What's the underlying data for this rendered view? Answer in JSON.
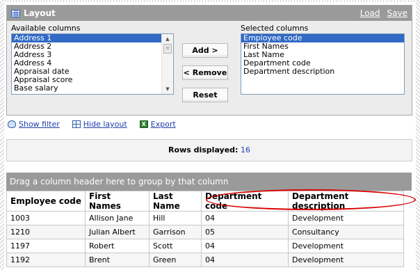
{
  "layout": {
    "title": "Layout",
    "load_label": "Load",
    "save_label": "Save",
    "available_label": "Available columns",
    "selected_label": "Selected columns",
    "available_items": [
      "Address 1",
      "Address 2",
      "Address 3",
      "Address 4",
      "Appraisal date",
      "Appraisal score",
      "Base salary"
    ],
    "selected_items": [
      "Employee code",
      "First Names",
      "Last Name",
      "Department code",
      "Department description"
    ],
    "add_label": "Add >",
    "remove_label": "< Remove",
    "reset_label": "Reset"
  },
  "toolbar": {
    "show_filter": "Show filter",
    "hide_layout": "Hide layout",
    "export": "Export"
  },
  "rows": {
    "label": "Rows displayed:",
    "count": "16"
  },
  "grid": {
    "group_hint": "Drag a column header here to group by that column",
    "headers": [
      "Employee code",
      "First Names",
      "Last Name",
      "Department code",
      "Department description"
    ],
    "rows": [
      [
        "1003",
        "Allison Jane",
        "Hill",
        "04",
        "Development"
      ],
      [
        "1210",
        "Julian Albert",
        "Garrison",
        "05",
        "Consultancy"
      ],
      [
        "1197",
        "Robert",
        "Scott",
        "04",
        "Development"
      ],
      [
        "1192",
        "Brent",
        "Green",
        "04",
        "Development"
      ]
    ]
  },
  "colors": {
    "header_gray": "#9a9a9a",
    "selection_blue": "#3169c6",
    "highlight_red": "#d90000",
    "link_blue": "#1f3fa8"
  }
}
